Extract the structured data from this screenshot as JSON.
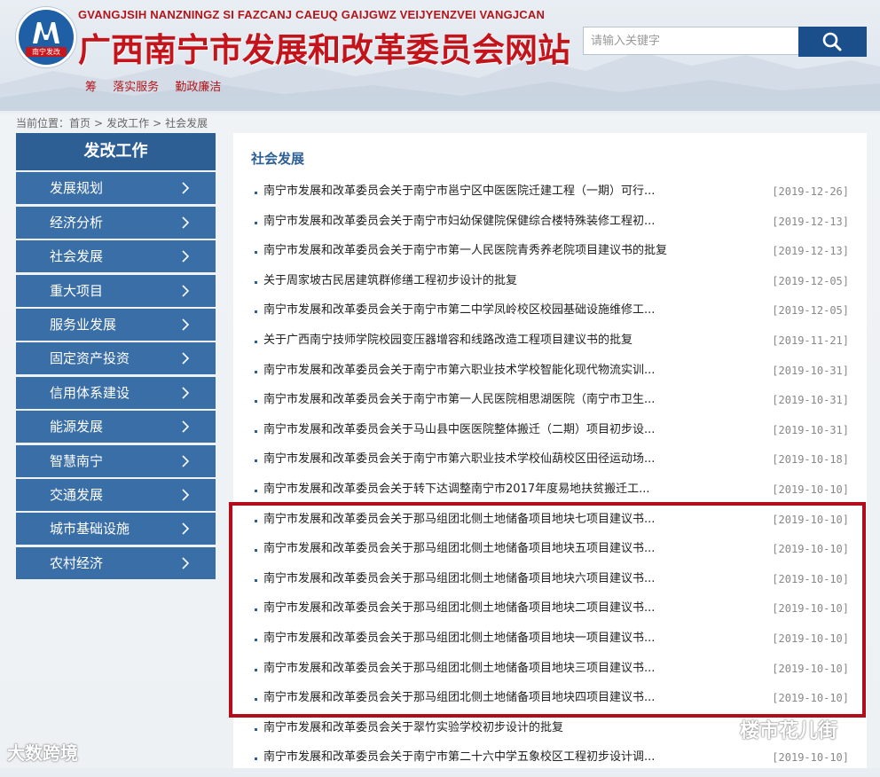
{
  "header": {
    "pinyin": "GVANGJSIH NANZNINGZ SI FAZCANJ CAEUQ GAIJGWZ VEIJYENZVEI VANGJCAN",
    "title": "广西南宁市发展和改革委员会网站",
    "logo_tag": "南宁发改",
    "search_placeholder": "请输入关键字",
    "quicklinks": [
      "筹",
      "落实服务",
      "勤政廉洁"
    ]
  },
  "breadcrumb": {
    "prefix": "当前位置：",
    "items": [
      "首页",
      "发改工作",
      "社会发展"
    ],
    "separator": ">"
  },
  "sidebar": {
    "title": "发改工作",
    "items": [
      {
        "label": "发展规划"
      },
      {
        "label": "经济分析"
      },
      {
        "label": "社会发展"
      },
      {
        "label": "重大项目"
      },
      {
        "label": "服务业发展"
      },
      {
        "label": "固定资产投资"
      },
      {
        "label": "信用体系建设"
      },
      {
        "label": "能源发展"
      },
      {
        "label": "智慧南宁"
      },
      {
        "label": "交通发展"
      },
      {
        "label": "城市基础设施"
      },
      {
        "label": "农村经济"
      }
    ]
  },
  "main": {
    "title": "社会发展",
    "articles": [
      {
        "title": "南宁市发展和改革委员会关于南宁市邕宁区中医医院迁建工程（一期）可行...",
        "date": "[2019-12-26]"
      },
      {
        "title": "南宁市发展和改革委员会关于南宁市妇幼保健院保健综合楼特殊装修工程初...",
        "date": "[2019-12-13]"
      },
      {
        "title": "南宁市发展和改革委员会关于南宁市第一人民医院青秀养老院项目建议书的批复",
        "date": "[2019-12-13]"
      },
      {
        "title": "关于周家坡古民居建筑群修缮工程初步设计的批复",
        "date": "[2019-12-05]"
      },
      {
        "title": "南宁市发展和改革委员会关于南宁市第二中学凤岭校区校园基础设施维修工...",
        "date": "[2019-12-05]"
      },
      {
        "title": "关于广西南宁技师学院校园变压器增容和线路改造工程项目建议书的批复",
        "date": "[2019-11-21]"
      },
      {
        "title": "南宁市发展和改革委员会关于南宁市第六职业技术学校智能化现代物流实训...",
        "date": "[2019-10-31]"
      },
      {
        "title": "南宁市发展和改革委员会关于南宁市第一人民医院相思湖医院（南宁市卫生...",
        "date": "[2019-10-31]"
      },
      {
        "title": "南宁市发展和改革委员会关于马山县中医医院整体搬迁（二期）项目初步设...",
        "date": "[2019-10-31]"
      },
      {
        "title": "南宁市发展和改革委员会关于南宁市第六职业技术学校仙葫校区田径运动场...",
        "date": "[2019-10-18]"
      },
      {
        "title": "南宁市发展和改革委员会关于转下达调整南宁市2017年度易地扶贫搬迁工...",
        "date": "[2019-10-10]"
      },
      {
        "title": "南宁市发展和改革委员会关于那马组团北侧土地储备项目地块七项目建议书...",
        "date": "[2019-10-10]"
      },
      {
        "title": "南宁市发展和改革委员会关于那马组团北侧土地储备项目地块五项目建议书...",
        "date": "[2019-10-10]"
      },
      {
        "title": "南宁市发展和改革委员会关于那马组团北侧土地储备项目地块六项目建议书...",
        "date": "[2019-10-10]"
      },
      {
        "title": "南宁市发展和改革委员会关于那马组团北侧土地储备项目地块二项目建议书...",
        "date": "[2019-10-10]"
      },
      {
        "title": "南宁市发展和改革委员会关于那马组团北侧土地储备项目地块一项目建议书...",
        "date": "[2019-10-10]"
      },
      {
        "title": "南宁市发展和改革委员会关于那马组团北侧土地储备项目地块三项目建议书...",
        "date": "[2019-10-10]"
      },
      {
        "title": "南宁市发展和改革委员会关于那马组团北侧土地储备项目地块四项目建议书...",
        "date": "[2019-10-10]"
      },
      {
        "title": "南宁市发展和改革委员会关于翠竹实验学校初步设计的批复",
        "date": ""
      },
      {
        "title": "南宁市发展和改革委员会关于南宁市第二十六中学五象校区工程初步设计调...",
        "date": "[2019-10-10]"
      }
    ]
  },
  "watermarks": {
    "left": "大数跨境",
    "right": "楼市花儿街"
  },
  "colors": {
    "brand_red": "#c4141b",
    "nav_blue": "#3a6ea6",
    "nav_head_blue": "#2d5f95",
    "search_btn": "#1a4f8b",
    "highlight_red": "#b30d1c"
  },
  "icons": {
    "search": "search-icon",
    "chevron": "chevron-right-icon",
    "logo": "ndrc-logo-icon",
    "bubble": "chat-bubble-icon"
  }
}
